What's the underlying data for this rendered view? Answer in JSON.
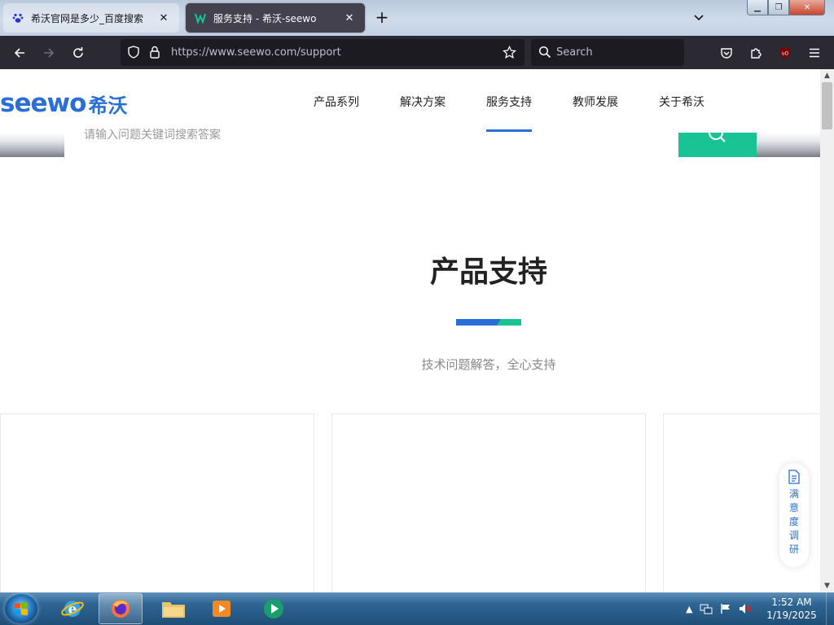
{
  "browser": {
    "tabs": [
      {
        "title": "希沃官网是多少_百度搜索",
        "favicon": "baidu-paw-icon",
        "active": false
      },
      {
        "title": "服务支持 - 希沃-seewo",
        "favicon": "seewo-icon",
        "active": true
      }
    ],
    "url": "https://www.seewo.com/support",
    "search_placeholder": "Search"
  },
  "site": {
    "logo_en": "seewo",
    "logo_cn": "希沃",
    "nav": [
      "产品系列",
      "解决方案",
      "服务支持",
      "教师发展",
      "关于希沃"
    ],
    "active_nav": "服务支持",
    "search_hint": "请输入问题关键词搜索答案",
    "section_title": "产品支持",
    "section_subtitle": "技术问题解答，全心支持",
    "survey_label": [
      "满",
      "意",
      "度",
      "调",
      "研"
    ]
  },
  "taskbar": {
    "time": "1:52 AM",
    "date": "1/19/2025"
  },
  "colors": {
    "brand_blue": "#2a6fd6",
    "brand_green": "#19c394",
    "toolbar": "#2b2a33"
  }
}
